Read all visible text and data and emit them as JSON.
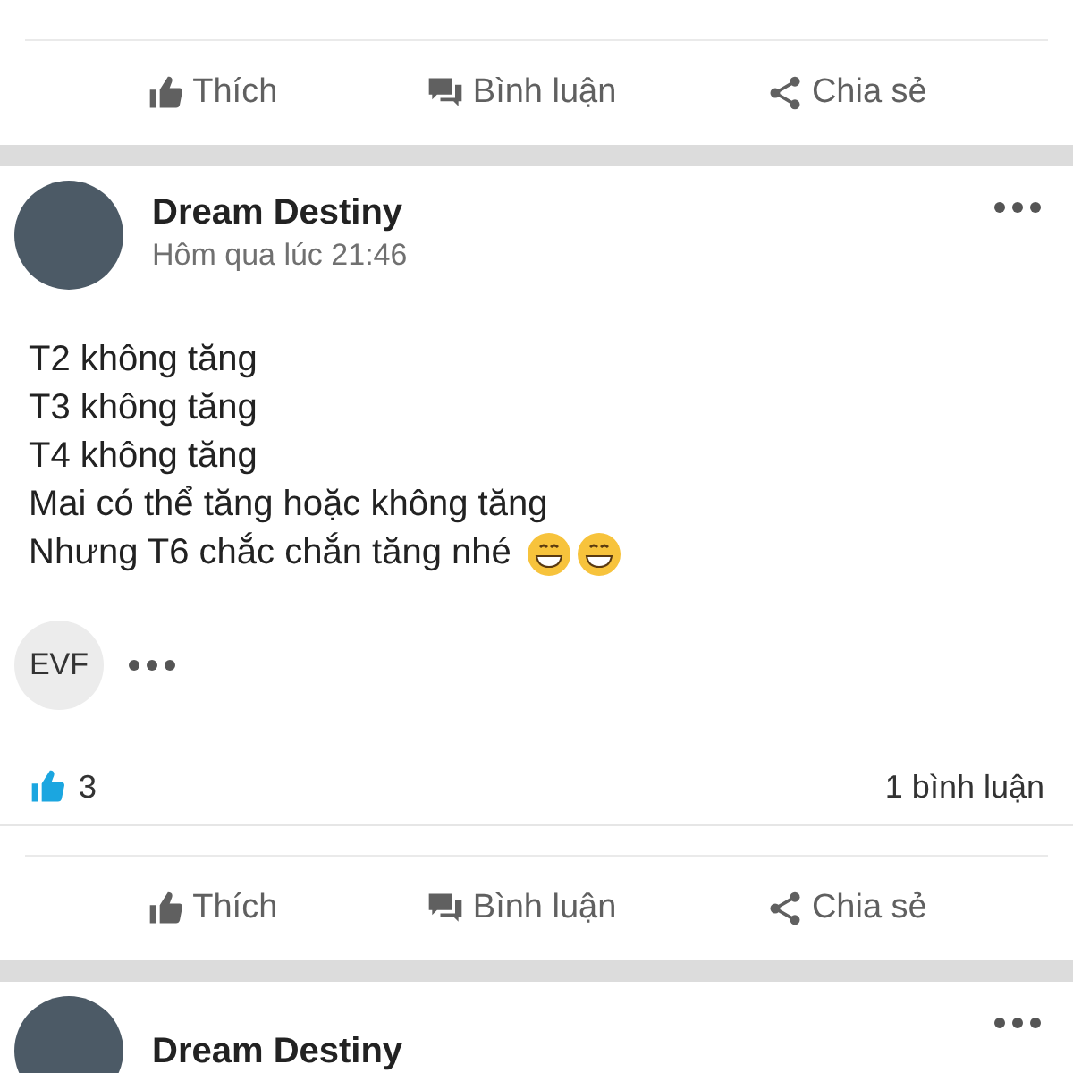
{
  "posts": [
    {
      "actions": [
        "Thích",
        "Bình luận",
        "Chia sẻ"
      ]
    },
    {
      "author": "Dream Destiny",
      "time": "Hôm qua lúc 21:46",
      "lines": [
        "T2 không tăng",
        "T3 không tăng",
        "T4 không tăng",
        "Mai có thể tăng hoặc không tăng",
        "Nhưng T6 chắc chắn tăng nhé"
      ],
      "tag": "EVF",
      "likes": "3",
      "comments": "1 bình luận",
      "actions": [
        "Thích",
        "Bình luận",
        "Chia sẻ"
      ]
    },
    {
      "author": "Dream Destiny"
    }
  ]
}
